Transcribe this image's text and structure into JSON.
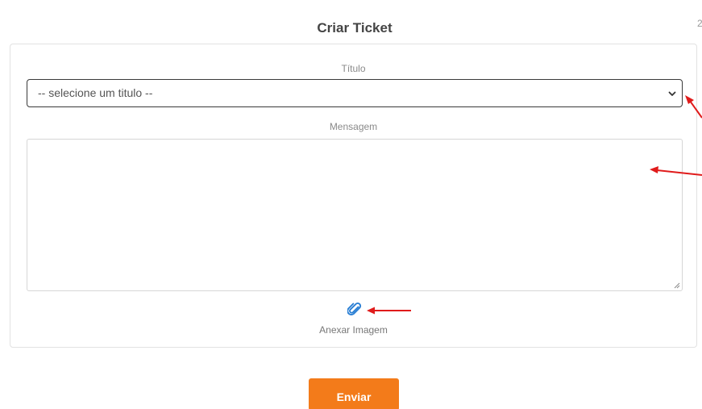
{
  "page": {
    "title": "Criar Ticket",
    "edge_mark": "2"
  },
  "form": {
    "titulo_label": "Título",
    "titulo_select": {
      "selected": "-- selecione um titulo --"
    },
    "mensagem_label": "Mensagem",
    "mensagem_value": "",
    "attach_label": "Anexar Imagem",
    "submit_label": "Enviar"
  },
  "colors": {
    "accent": "#f37b1a",
    "annotation_arrow": "#e01b1b",
    "attach_icon": "#2a7fd4"
  },
  "icons": {
    "select_toggle": "chevron-down-icon",
    "attach": "paperclip-icon",
    "resize": "resize-grip-icon"
  }
}
